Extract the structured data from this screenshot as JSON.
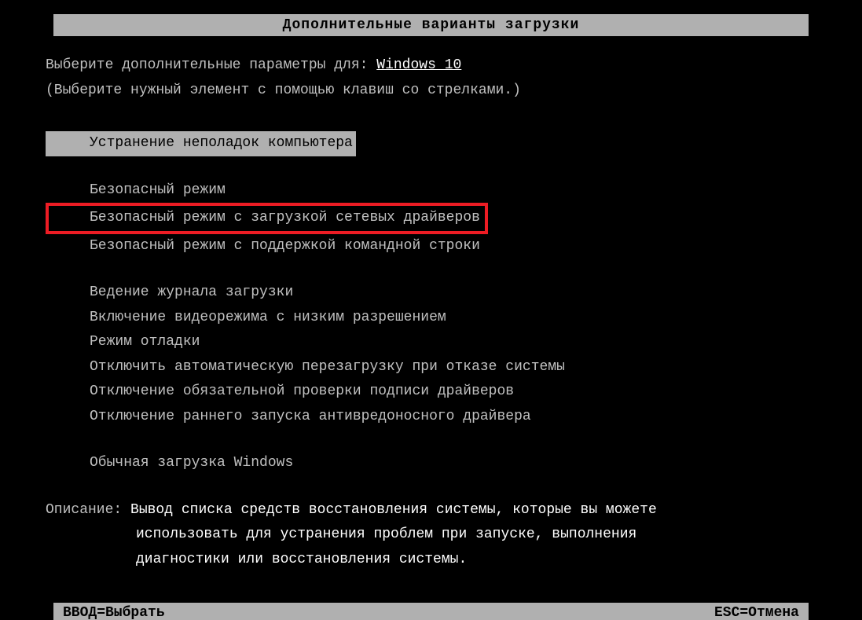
{
  "header": {
    "title": "Дополнительные варианты загрузки"
  },
  "instruction": {
    "prefix": "Выберите дополнительные параметры для: ",
    "os": "Windows 10",
    "hint": "(Выберите нужный элемент с помощью клавиш со стрелками.)"
  },
  "menu": {
    "selected": "Устранение неполадок компьютера",
    "group1": [
      "Безопасный режим",
      "Безопасный режим с загрузкой сетевых драйверов",
      "Безопасный режим с поддержкой командной строки"
    ],
    "group2": [
      "Ведение журнала загрузки",
      "Включение видеорежима с низким разрешением",
      "Режим отладки",
      "Отключить автоматическую перезагрузку при отказе системы",
      "Отключение обязательной проверки подписи драйверов",
      "Отключение раннего запуска антивредоносного драйвера"
    ],
    "group3": [
      "Обычная загрузка Windows"
    ]
  },
  "description": {
    "label": "Описание: ",
    "line1": "Вывод списка средств восстановления системы, которые вы можете",
    "line2": "использовать для устранения проблем при запуске, выполнения",
    "line3": "диагностики или восстановления системы."
  },
  "footer": {
    "enter": "ВВОД=Выбрать",
    "esc": "ESC=Отмена"
  }
}
